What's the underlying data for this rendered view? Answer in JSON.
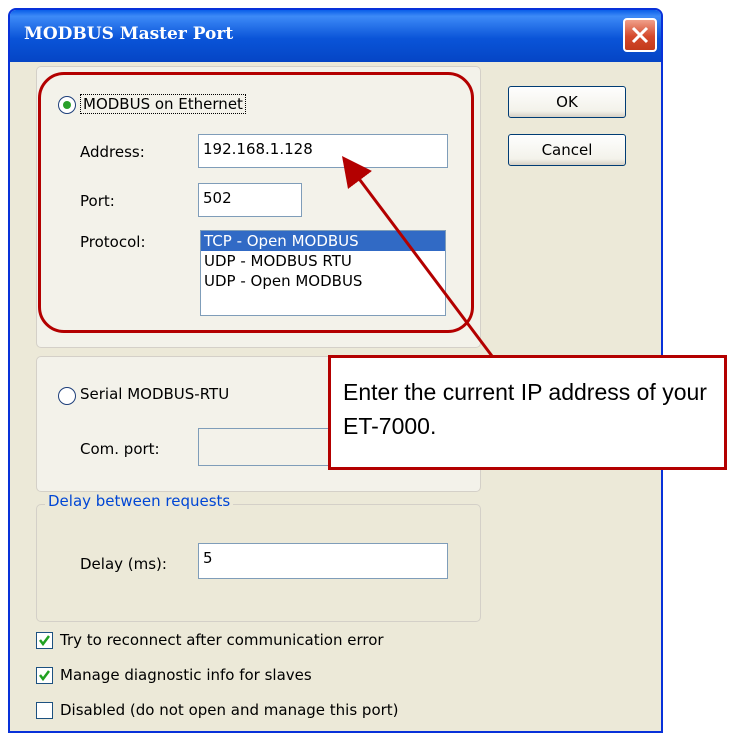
{
  "window": {
    "title": "MODBUS Master Port"
  },
  "ethernet": {
    "radio_label": "MODBUS on Ethernet",
    "address_label": "Address:",
    "address_value": "192.168.1.128",
    "port_label": "Port:",
    "port_value": "502",
    "protocol_label": "Protocol:",
    "protocols": [
      "TCP - Open MODBUS",
      "UDP - MODBUS RTU",
      "UDP - Open MODBUS"
    ],
    "selected_protocol": "TCP - Open MODBUS"
  },
  "serial": {
    "radio_label": "Serial MODBUS-RTU",
    "com_port_label": "Com. port:",
    "com_port_value": ""
  },
  "delay": {
    "group_label": "Delay between requests",
    "delay_label": "Delay (ms):",
    "delay_value": "5"
  },
  "buttons": {
    "ok": "OK",
    "cancel": "Cancel"
  },
  "options": {
    "reconnect": {
      "label": "Try to reconnect after communication error",
      "checked": true
    },
    "diagnostic": {
      "label": "Manage diagnostic info for slaves",
      "checked": true
    },
    "disabled": {
      "label": "Disabled (do not open and manage this port)",
      "checked": false
    }
  },
  "annotation": {
    "text": "Enter the current IP address of your ET-7000."
  },
  "colors": {
    "annotation": "#b30000",
    "titlebar": "#0a54d8",
    "selection": "#316ac5"
  }
}
